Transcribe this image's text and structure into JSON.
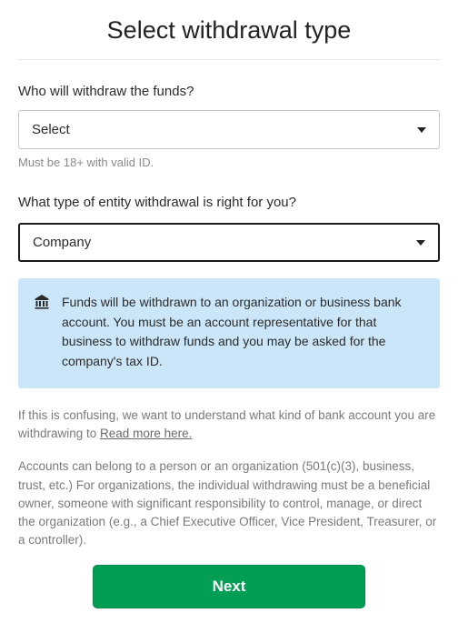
{
  "title": "Select withdrawal type",
  "who": {
    "label": "Who will withdraw the funds?",
    "selected": "Select",
    "hint": "Must be 18+ with valid ID."
  },
  "entity": {
    "label": "What type of entity withdrawal is right for you?",
    "selected": "Company"
  },
  "info": {
    "text": "Funds will be withdrawn to an organization or business bank account. You must be an account representative for that business to withdraw funds and you may be asked for the company's tax ID."
  },
  "help1": {
    "text": "If this is confusing, we want to understand what kind of bank account you are withdrawing to ",
    "link": "Read more here."
  },
  "help2": "Accounts can belong to a person or an organization (501(c)(3), business, trust, etc.) For organizations, the individual withdrawing must be a beneficial owner, someone with significant responsibility to control, manage, or direct the organization (e.g., a Chief Executive Officer, Vice President, Treasurer, or a controller).",
  "next": "Next"
}
